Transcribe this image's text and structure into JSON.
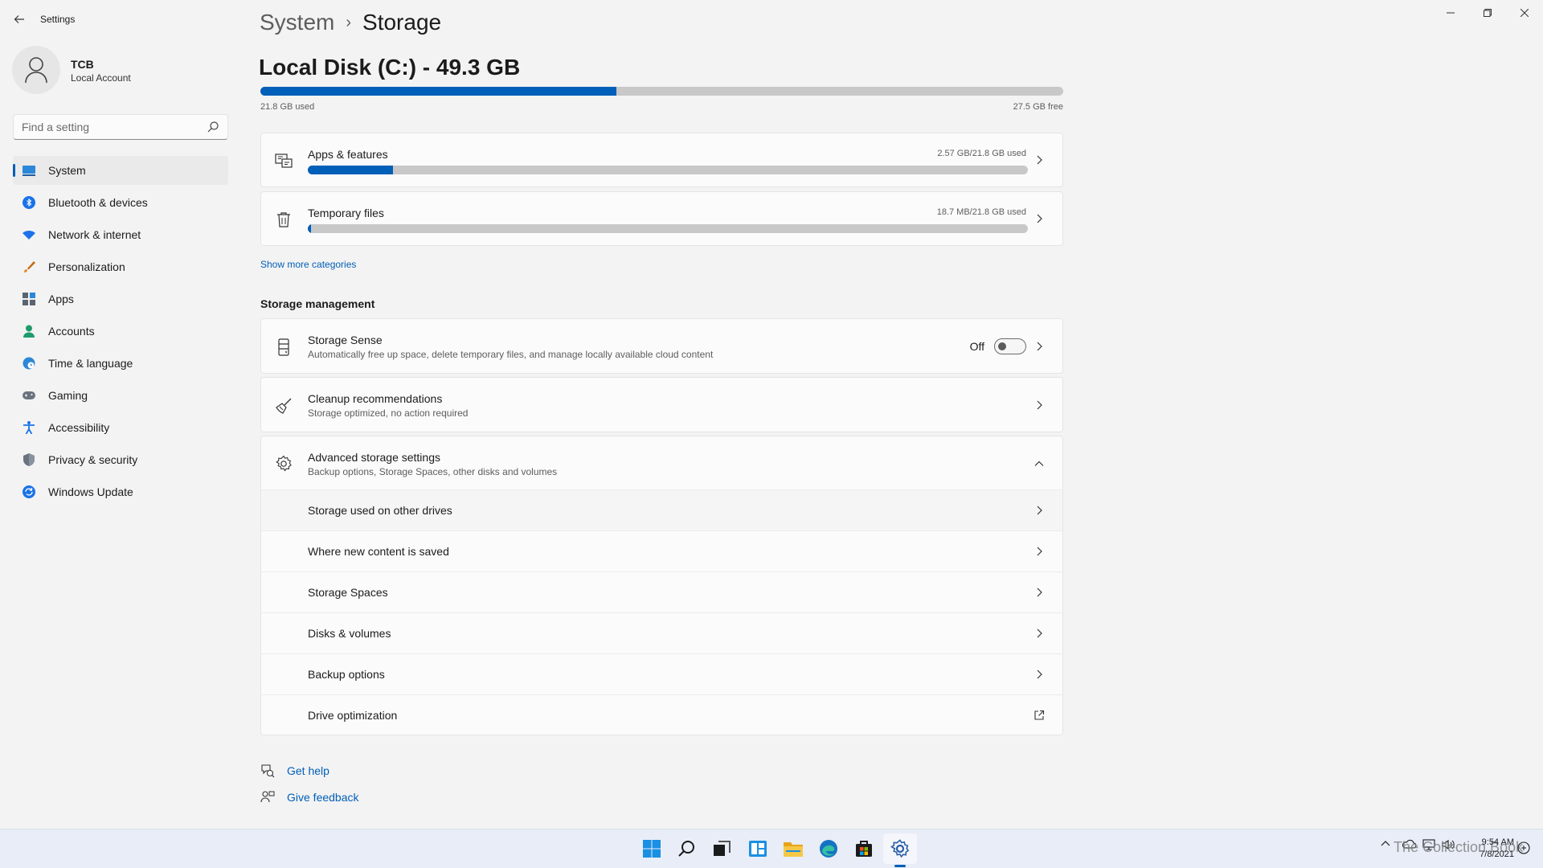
{
  "window": {
    "app_title": "Settings",
    "back_icon": "back-arrow-icon",
    "min_icon": "minimize-icon",
    "max_icon": "maximize-icon",
    "close_icon": "close-icon"
  },
  "user": {
    "name": "TCB",
    "account_type": "Local Account"
  },
  "search": {
    "placeholder": "Find a setting",
    "value": ""
  },
  "sidebar": {
    "items": [
      {
        "label": "System",
        "icon": "monitor-icon",
        "active": true
      },
      {
        "label": "Bluetooth & devices",
        "icon": "bluetooth-icon"
      },
      {
        "label": "Network & internet",
        "icon": "wifi-icon"
      },
      {
        "label": "Personalization",
        "icon": "brush-icon"
      },
      {
        "label": "Apps",
        "icon": "apps-icon"
      },
      {
        "label": "Accounts",
        "icon": "person-icon"
      },
      {
        "label": "Time & language",
        "icon": "globe-clock-icon"
      },
      {
        "label": "Gaming",
        "icon": "gamepad-icon"
      },
      {
        "label": "Accessibility",
        "icon": "accessibility-icon"
      },
      {
        "label": "Privacy & security",
        "icon": "shield-icon"
      },
      {
        "label": "Windows Update",
        "icon": "update-icon"
      }
    ]
  },
  "breadcrumb": {
    "parent": "System",
    "separator": "›",
    "current": "Storage"
  },
  "disk": {
    "title": "Local Disk (C:) - 49.3 GB",
    "used_label": "21.8 GB used",
    "free_label": "27.5 GB free",
    "used_fraction": 0.443
  },
  "categories": [
    {
      "title": "Apps & features",
      "meta": "2.57 GB/21.8 GB used",
      "fraction": 0.118,
      "icon": "apps-features-icon"
    },
    {
      "title": "Temporary files",
      "meta": "18.7 MB/21.8 GB used",
      "fraction": 0.004,
      "icon": "trash-icon"
    }
  ],
  "show_more": "Show more categories",
  "storage_management": {
    "heading": "Storage management",
    "storage_sense": {
      "title": "Storage Sense",
      "subtitle": "Automatically free up space, delete temporary files, and manage locally available cloud content",
      "toggle_label": "Off",
      "toggle_on": false
    },
    "cleanup": {
      "title": "Cleanup recommendations",
      "subtitle": "Storage optimized, no action required"
    },
    "advanced": {
      "title": "Advanced storage settings",
      "subtitle": "Backup options, Storage Spaces, other disks and volumes",
      "expanded": true,
      "items": [
        {
          "label": "Storage used on other drives"
        },
        {
          "label": "Where new content is saved"
        },
        {
          "label": "Storage Spaces"
        },
        {
          "label": "Disks & volumes"
        },
        {
          "label": "Backup options"
        },
        {
          "label": "Drive optimization",
          "external": true
        }
      ]
    }
  },
  "help": {
    "get_help": "Get help",
    "give_feedback": "Give feedback"
  },
  "taskbar": {
    "icons": [
      "windows-start-icon",
      "search-icon",
      "task-view-icon",
      "widgets-icon",
      "file-explorer-icon",
      "edge-icon",
      "store-icon",
      "settings-icon"
    ],
    "time": "9:54 AM",
    "date": "7/8/2021",
    "watermark": "The Collection Book"
  },
  "colors": {
    "accent": "#005fb8",
    "bar_track": "#c8c8c8",
    "background": "#f3f3f3",
    "card": "#fbfbfb",
    "taskbar": "#e8edf7"
  }
}
